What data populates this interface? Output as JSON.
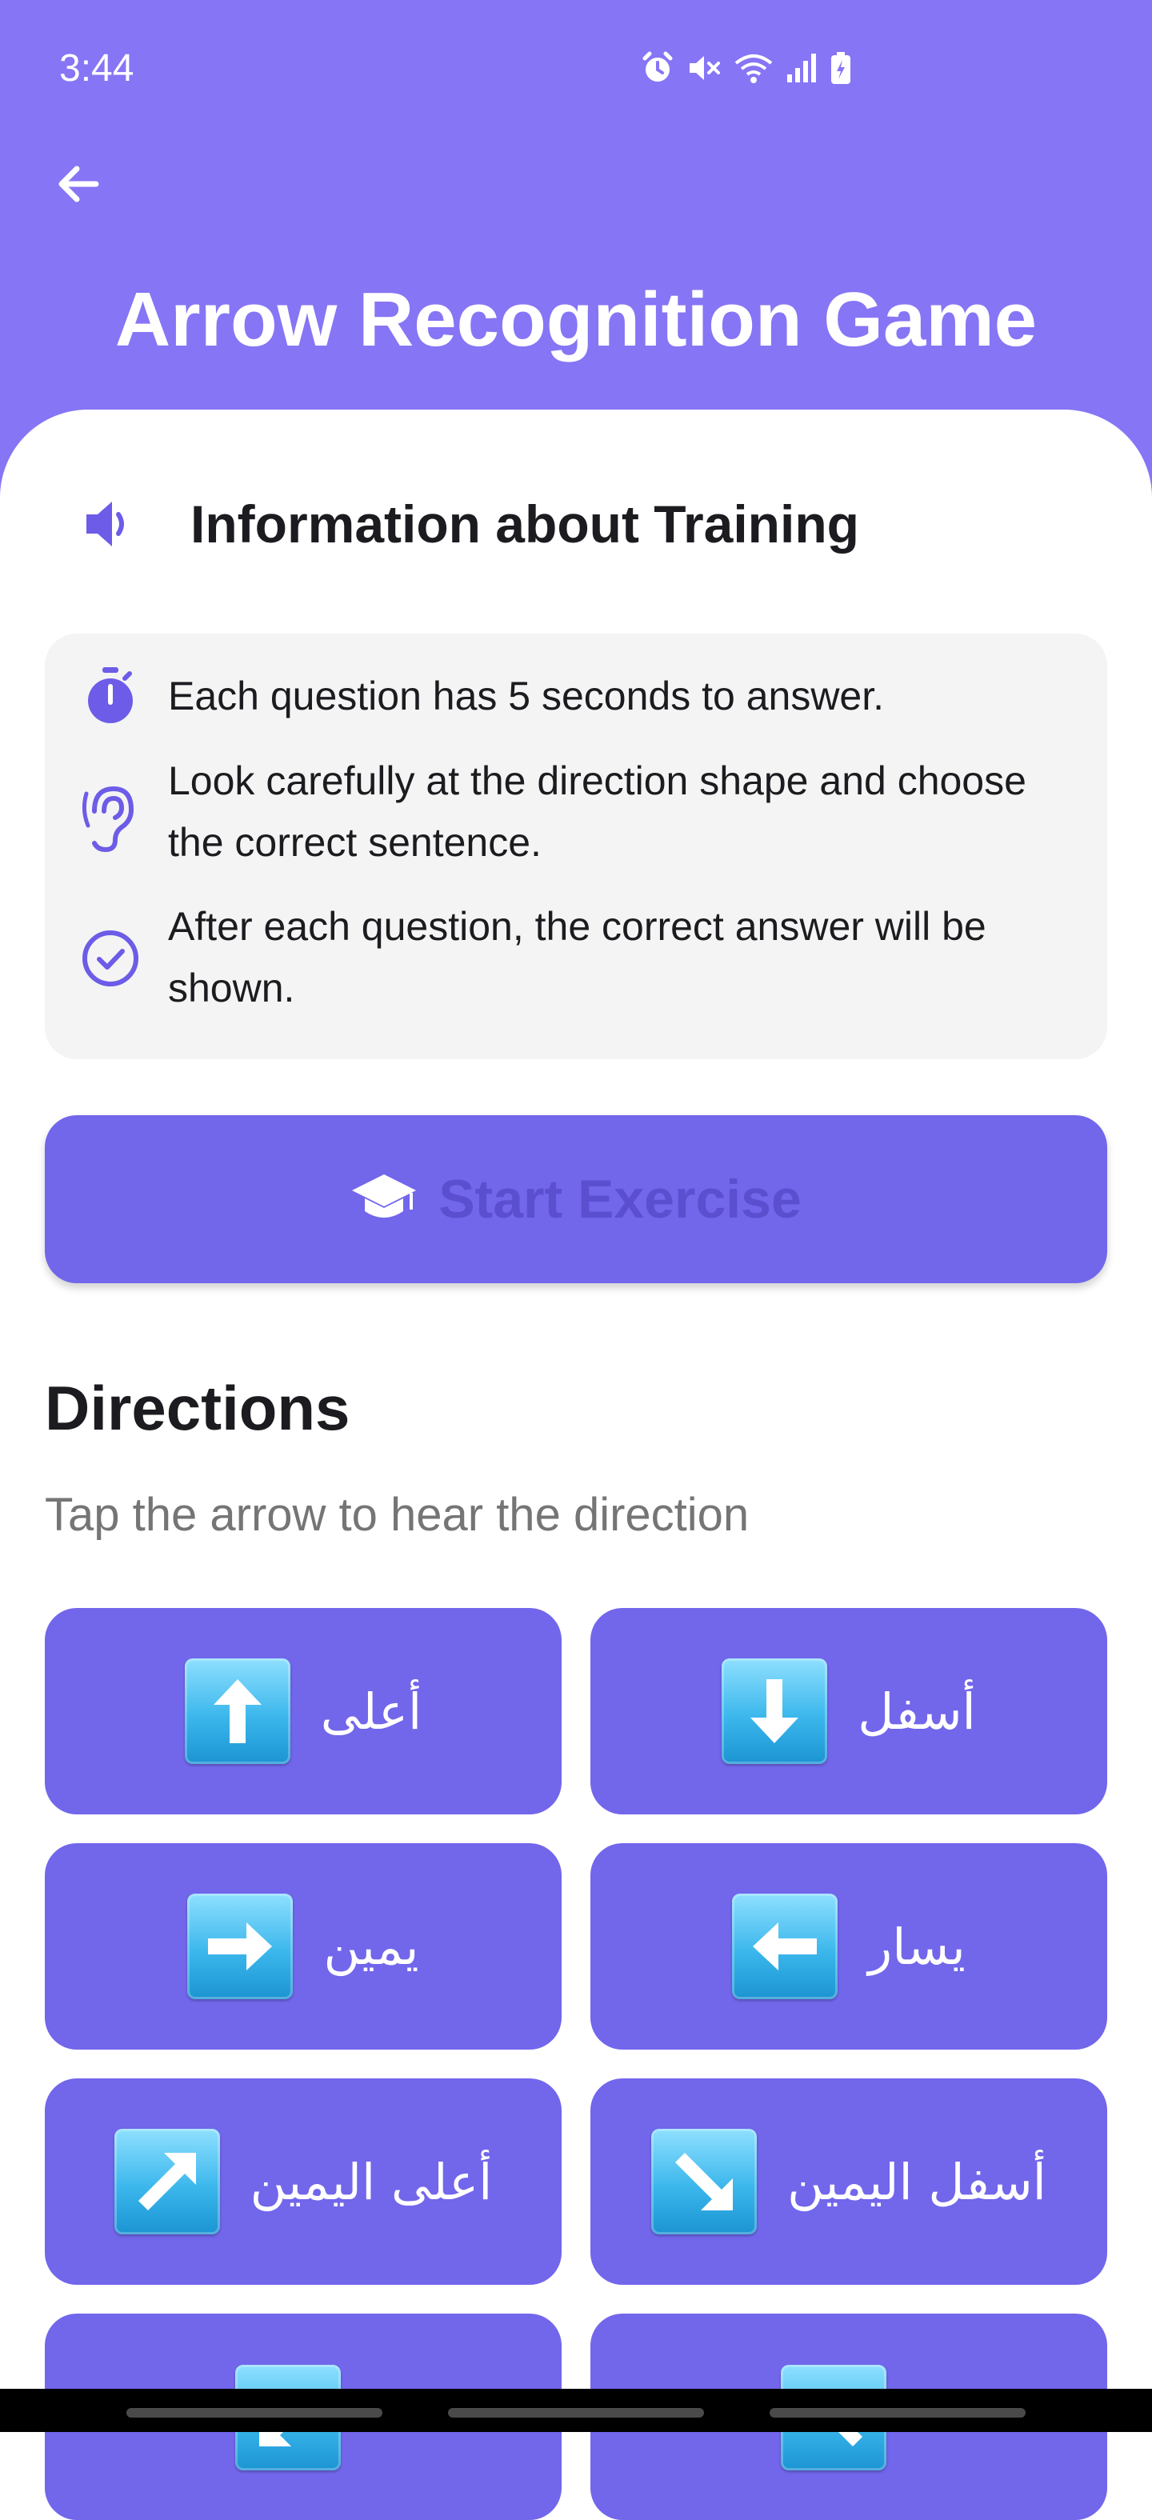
{
  "status_bar": {
    "time": "3:44",
    "icons": [
      "alarm-icon",
      "mute-icon",
      "wifi-icon",
      "signal-icon",
      "battery-charging-icon"
    ]
  },
  "app_bar": {
    "back_icon": "arrow-left-icon",
    "title": "Arrow Recognition Game"
  },
  "info": {
    "icon": "speaker-icon",
    "title": "Information about Training",
    "items": [
      {
        "icon": "timer-icon",
        "text": "Each question has 5 seconds to answer."
      },
      {
        "icon": "ear-icon",
        "text": "Look carefully at the direction shape and choose the correct sentence."
      },
      {
        "icon": "check-circle-icon",
        "text": "After each question, the correct answer will be shown."
      }
    ]
  },
  "start_button": {
    "icon": "graduation-cap-icon",
    "label": "Start Exercise"
  },
  "directions": {
    "title": "Directions",
    "subtitle": "Tap the arrow to hear the direction",
    "items": [
      {
        "icon": "arrow-up-icon",
        "label": "أعلى"
      },
      {
        "icon": "arrow-down-icon",
        "label": "أسفل"
      },
      {
        "icon": "arrow-right-icon",
        "label": "يمين"
      },
      {
        "icon": "arrow-left-icon",
        "label": "يسار"
      },
      {
        "icon": "arrow-up-right-icon",
        "label": "أعلى اليمين"
      },
      {
        "icon": "arrow-down-right-icon",
        "label": "أسفل اليمين"
      },
      {
        "icon": "arrow-down-left-icon",
        "label": ""
      },
      {
        "icon": "arrow-up-left-icon",
        "label": ""
      }
    ]
  },
  "colors": {
    "header": "#8675f5",
    "primary": "#7266eb",
    "button_text": "#5b4fcf",
    "icon_accent": "#6c5ce7",
    "card_background": "#f4f4f4"
  }
}
